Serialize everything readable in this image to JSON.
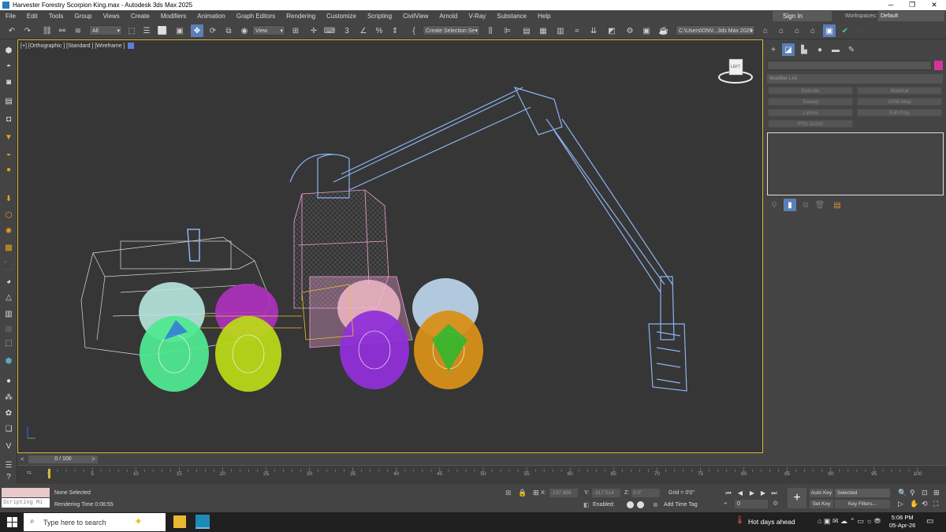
{
  "window": {
    "title": "Harvester Forestry Scorpion King.max - Autodesk 3ds Max 2025",
    "minimize": "─",
    "restore": "❐",
    "close": "✕"
  },
  "menu": [
    "File",
    "Edit",
    "Tools",
    "Group",
    "Views",
    "Create",
    "Modifiers",
    "Animation",
    "Graph Editors",
    "Rendering",
    "Customize",
    "Scripting",
    "CivilView",
    "Arnold",
    "V-Ray",
    "Substance",
    "Help"
  ],
  "signin": "Sign In",
  "workspaces": {
    "label": "Workspaces:",
    "value": "Default"
  },
  "toolbar": {
    "filter": "All",
    "refcoord": "View",
    "selection_set": "Create Selection Se",
    "project_path": "C:\\Users\\ONV...3ds Max 2025",
    "percent_icon": "%"
  },
  "viewport": {
    "label": "[+] [Orthographic ] [Standard ] [Wireframe ]",
    "viewcube_label": "LEFT"
  },
  "command_panel": {
    "modifier_list": "Modifier List",
    "buttons": [
      "Extrude",
      "Material",
      "Sweep",
      "UVW Map",
      "Lattice",
      "Edit Poly",
      "FFD 2x2x2"
    ]
  },
  "timeslider": {
    "position": "0 / 100",
    "ticks": [
      "0",
      "5",
      "10",
      "15",
      "20",
      "25",
      "30",
      "35",
      "40",
      "45",
      "50",
      "55",
      "60",
      "65",
      "70",
      "75",
      "80",
      "85",
      "90",
      "95",
      "100"
    ]
  },
  "status": {
    "maxscript": "Scripting Mi",
    "selection": "None Selected",
    "render_time": "Rendering Time  0:06:55",
    "x_label": "X:",
    "x_value": "-137.869",
    "y_label": "Y:",
    "y_value": "-317.514",
    "z_label": "Z:",
    "z_value": "0.0\"",
    "grid": "Grid = 0'0\"",
    "enabled": "Enabled:",
    "add_time_tag": "Add Time Tag",
    "frame": "0",
    "auto_key": "Auto Key",
    "set_key": "Set Key",
    "key_selected": "Selected",
    "key_filters": "Key Filters..."
  },
  "taskbar": {
    "search_placeholder": "Type here to search",
    "weather": "Hot days ahead",
    "time": "5:06 PM",
    "date": "05-Apr-26"
  },
  "colors": {
    "viewport_bg": "#363636",
    "viewport_border": "#d8b838",
    "accent": "#5b7fb8",
    "boom": "#8ab4f0",
    "cab": "#f0a0d8"
  }
}
